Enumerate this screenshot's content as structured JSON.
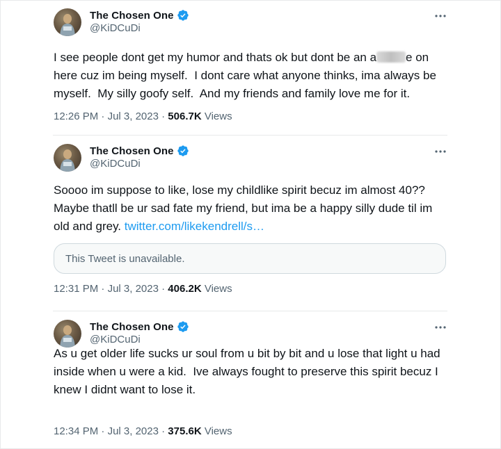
{
  "tweets": [
    {
      "author_name": "The Chosen One",
      "handle": "@KiDCuDi",
      "text_before_censor": "I see people dont get my humor and thats ok but dont be an a",
      "text_after_censor": "e on here cuz im being myself.  I dont care what anyone thinks, ima always be myself.  My silly goofy self.  And my friends and family love me for it.",
      "time": "12:26 PM",
      "date": "Jul 3, 2023",
      "views_count": "506.7K",
      "views_label": "Views"
    },
    {
      "author_name": "The Chosen One",
      "handle": "@KiDCuDi",
      "text": "Soooo im suppose to like, lose my childlike spirit becuz im almost 40?? Maybe thatll be ur sad fate my friend, but ima be a happy silly dude til im old and grey. ",
      "link": "twitter.com/likekendrell/s…",
      "quoted_status": "This Tweet is unavailable.",
      "time": "12:31 PM",
      "date": "Jul 3, 2023",
      "views_count": "406.2K",
      "views_label": "Views"
    },
    {
      "author_name": "The Chosen One",
      "handle": "@KiDCuDi",
      "text": "As u get older life sucks ur soul from u bit by bit and u lose that light u had inside when u were a kid.  Ive always fought to preserve this spirit becuz I knew I didnt want to lose it.",
      "time": "12:34 PM",
      "date": "Jul 3, 2023",
      "views_count": "375.6K",
      "views_label": "Views"
    }
  ],
  "separator": "·",
  "icons": {
    "verified": "verified-badge-icon",
    "more": "more-options-icon"
  },
  "colors": {
    "verified_blue": "#1d9bf0",
    "link_blue": "#1d9bf0",
    "secondary_text": "#536471",
    "primary_text": "#0f1419"
  }
}
